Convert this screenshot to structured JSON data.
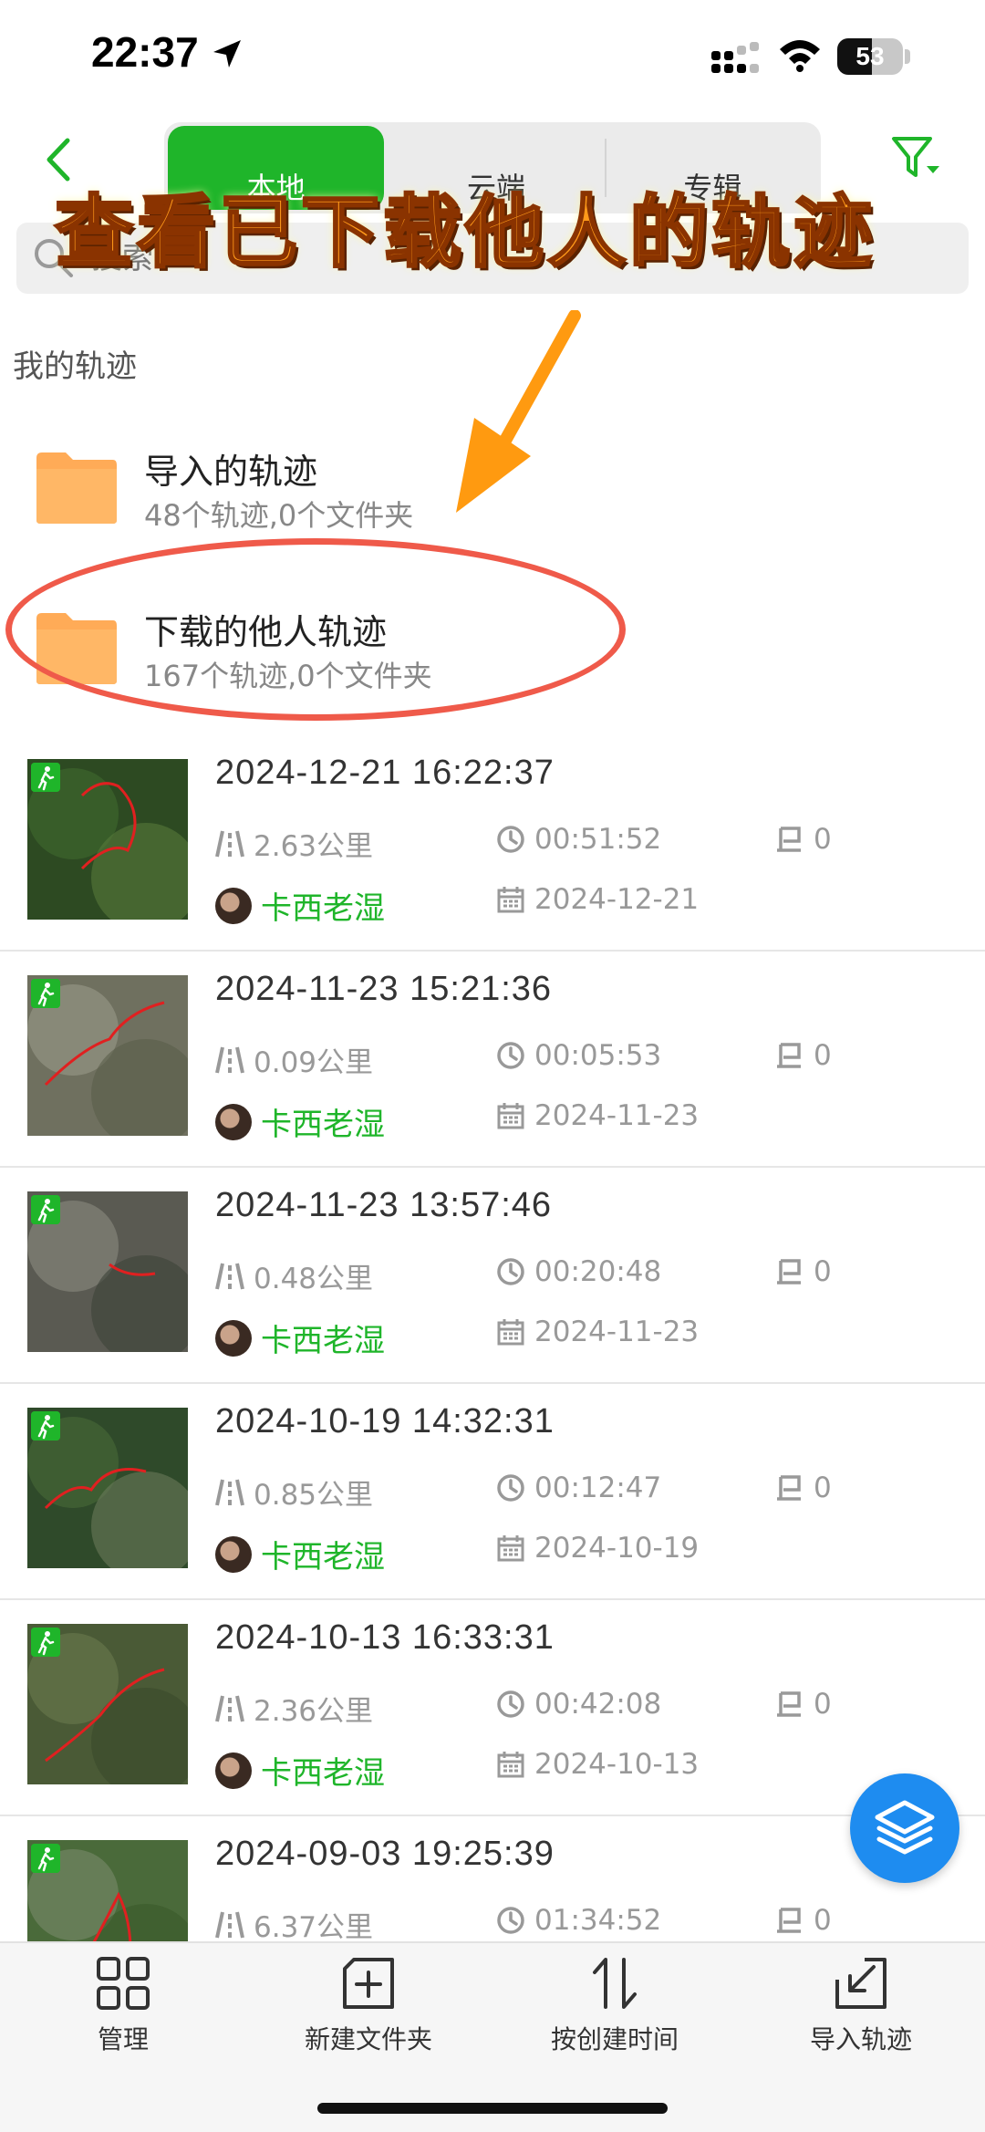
{
  "status_bar": {
    "time": "22:37",
    "battery": "53",
    "battery_level": 0.53
  },
  "nav": {
    "tabs": [
      {
        "label": "本地",
        "active": true
      },
      {
        "label": "云端",
        "active": false
      },
      {
        "label": "专辑",
        "active": false
      }
    ]
  },
  "search": {
    "placeholder": "搜索"
  },
  "overlay": {
    "banner": "查看已下载他人的轨迹"
  },
  "section_title": "我的轨迹",
  "folders": [
    {
      "name": "导入的轨迹",
      "summary": "48个轨迹,0个文件夹"
    },
    {
      "name": "下载的他人轨迹",
      "summary": "167个轨迹,0个文件夹"
    }
  ],
  "tracks": [
    {
      "title": "2024-12-21 16:22:37",
      "distance": "2.63公里",
      "duration": "00:51:52",
      "markers": "0",
      "author": "卡西老湿",
      "date": "2024-12-21"
    },
    {
      "title": "2024-11-23 15:21:36",
      "distance": "0.09公里",
      "duration": "00:05:53",
      "markers": "0",
      "author": "卡西老湿",
      "date": "2024-11-23"
    },
    {
      "title": "2024-11-23 13:57:46",
      "distance": "0.48公里",
      "duration": "00:20:48",
      "markers": "0",
      "author": "卡西老湿",
      "date": "2024-11-23"
    },
    {
      "title": "2024-10-19 14:32:31",
      "distance": "0.85公里",
      "duration": "00:12:47",
      "markers": "0",
      "author": "卡西老湿",
      "date": "2024-10-19"
    },
    {
      "title": "2024-10-13 16:33:31",
      "distance": "2.36公里",
      "duration": "00:42:08",
      "markers": "0",
      "author": "卡西老湿",
      "date": "2024-10-13"
    },
    {
      "title": "2024-09-03 19:25:39",
      "distance": "6.37公里",
      "duration": "01:34:52",
      "markers": "0",
      "author": "",
      "date": ""
    }
  ],
  "toolbar": {
    "manage": "管理",
    "new_folder": "新建文件夹",
    "sort": "按创建时间",
    "import": "导入轨迹"
  },
  "colors": {
    "accent": "#1fb52a",
    "fab": "#1e8cf0",
    "folder": "#ffab57",
    "overlay_text": "#ff9a1a",
    "annotation": "#ef5a4a"
  }
}
